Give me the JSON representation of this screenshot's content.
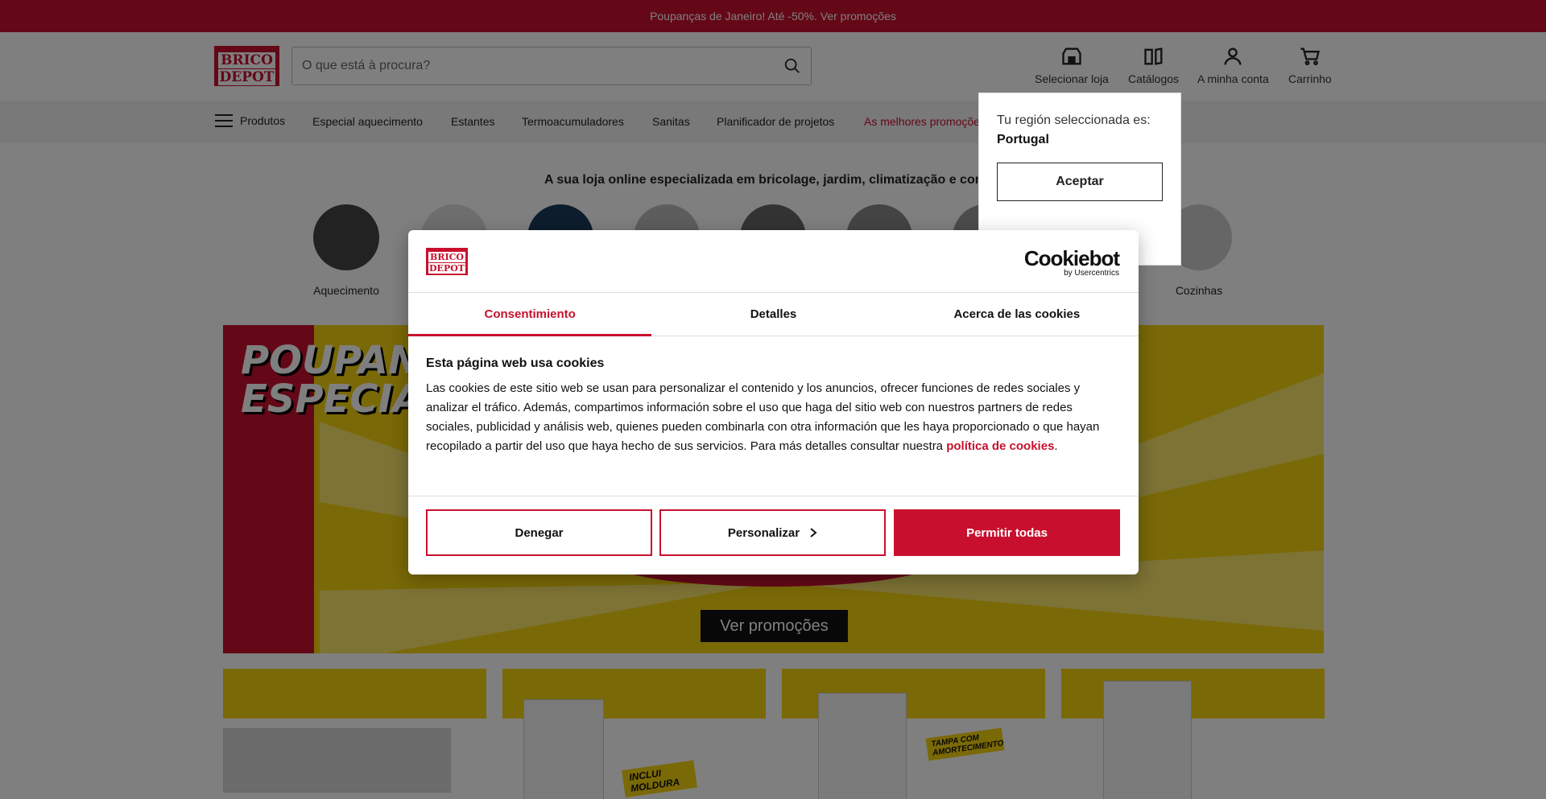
{
  "promo_bar": {
    "text": "Poupanças de Janeiro! Até -50%. Ver promoções"
  },
  "header": {
    "logo_top": "BRICO",
    "logo_bottom": "DEPOT",
    "search_placeholder": "O que está à procura?",
    "buttons": [
      {
        "label": "Selecionar loja",
        "icon": "store-icon"
      },
      {
        "label": "Catálogos",
        "icon": "book-icon"
      },
      {
        "label": "A minha conta",
        "icon": "user-icon"
      },
      {
        "label": "Carrinho",
        "icon": "cart-icon"
      }
    ]
  },
  "nav": {
    "menu_label": "Produtos",
    "items": [
      "Especial aquecimento",
      "Estantes",
      "Termoacumuladores",
      "Sanitas",
      "Planificador de projetos",
      "As melhores promoções"
    ]
  },
  "tagline": "A sua loja online especializada em bricolage, jardim, climatização e constru",
  "categories": [
    {
      "label": "Aquecimento"
    },
    {
      "label": "Cozinhas"
    }
  ],
  "banner": {
    "title": "POUPANÇ\nESPECIALI",
    "button": "Ver promoções"
  },
  "product_badges": [
    "INCLUI MOLDURA",
    "TAMPA COM AMORTECIMENTO"
  ],
  "region_popup": {
    "text": "Tu región seleccionada es:",
    "value": "Portugal",
    "accept": "Aceptar"
  },
  "cookie_modal": {
    "logo_top": "BRICO",
    "logo_bottom": "DEPOT",
    "brand": "Cookiebot",
    "brand_sub": "by Usercentrics",
    "tabs": [
      "Consentimiento",
      "Detalles",
      "Acerca de las cookies"
    ],
    "heading": "Esta página web usa cookies",
    "body": "Las cookies de este sitio web se usan para personalizar el contenido y los anuncios, ofrecer funciones de redes sociales y analizar el tráfico. Además, compartimos información sobre el uso que haga del sitio web con nuestros partners de redes sociales, publicidad y análisis web, quienes pueden combinarla con otra información que les haya proporcionado o que hayan recopilado a partir del uso que haya hecho de sus servicios. Para más detalles consultar nuestra ",
    "policy_link": "política de cookies",
    "body_end": ".",
    "deny": "Denegar",
    "customize": "Personalizar",
    "allow_all": "Permitir todas"
  },
  "colors": {
    "brand_red": "#c8102e",
    "banner_yellow": "#f5d30f"
  }
}
